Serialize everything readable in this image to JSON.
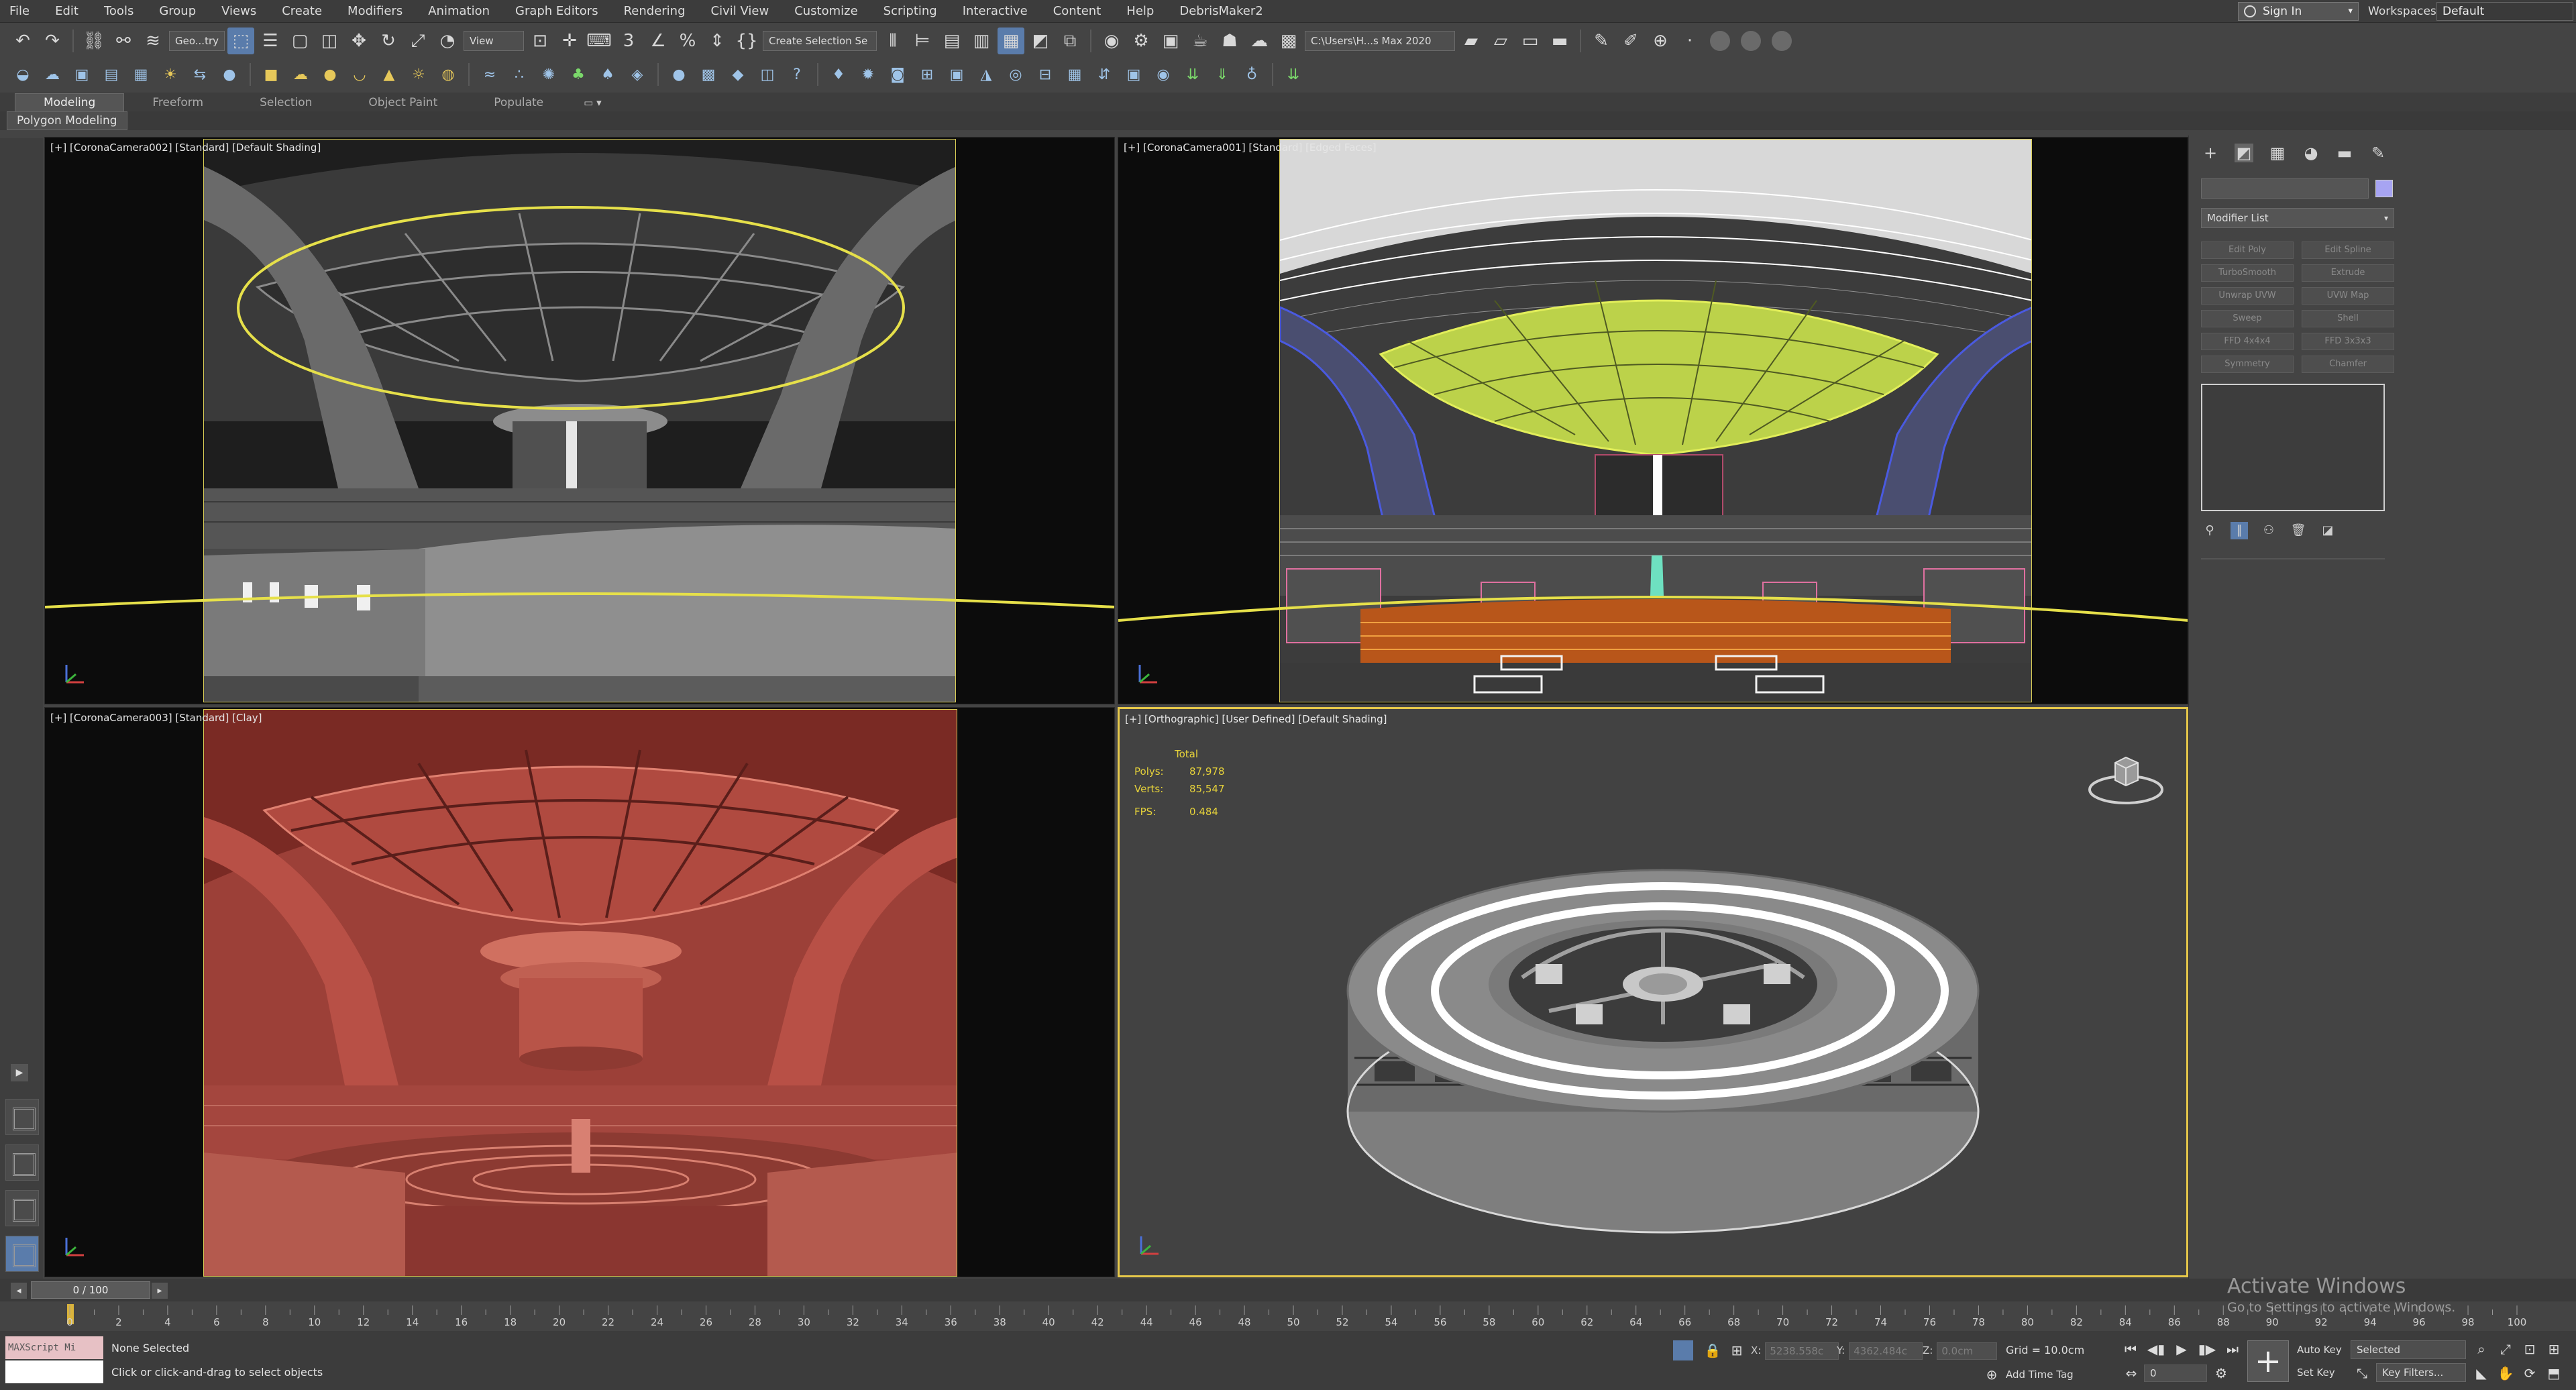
{
  "menubar": {
    "items": [
      "File",
      "Edit",
      "Tools",
      "Group",
      "Views",
      "Create",
      "Modifiers",
      "Animation",
      "Graph Editors",
      "Rendering",
      "Civil View",
      "Customize",
      "Scripting",
      "Interactive",
      "Content",
      "Help",
      "DebrisMaker2"
    ],
    "sign_in": "Sign In",
    "workspaces_label": "Workspaces:",
    "workspace_value": "Default"
  },
  "toolbar": {
    "selection_filter": "Geo...try",
    "ref_coord": "View",
    "selection_set": "Create Selection Se",
    "project_path": "C:\\Users\\H...s Max 2020"
  },
  "ribbon": {
    "tabs": [
      "Modeling",
      "Freeform",
      "Selection",
      "Object Paint",
      "Populate"
    ],
    "panel_label": "Polygon Modeling"
  },
  "viewports": {
    "tl_label": "[+] [CoronaCamera002] [Standard] [Default Shading]",
    "tr_label": "[+] [CoronaCamera001] [Standard] [Edged Faces]",
    "bl_label": "[+] [CoronaCamera003] [Standard] [Clay]",
    "br_label": "[+] [Orthographic] [User Defined] [Default Shading]",
    "stats": {
      "total_label": "Total",
      "polys_label": "Polys:",
      "polys_value": "87,978",
      "verts_label": "Verts:",
      "verts_value": "85,547",
      "fps_label": "FPS:",
      "fps_value": "0.484"
    }
  },
  "command_panel": {
    "modifier_list": "Modifier List",
    "modifiers": [
      "Edit Poly",
      "Edit Spline",
      "TurboSmooth",
      "Extrude",
      "Unwrap UVW",
      "UVW Map",
      "Sweep",
      "Shell",
      "FFD 4x4x4",
      "FFD 3x3x3",
      "Symmetry",
      "Chamfer"
    ],
    "object_color": "#a7a4f2"
  },
  "timeline": {
    "frame_display": "0 / 100",
    "ticks": [
      0,
      2,
      4,
      6,
      8,
      10,
      12,
      14,
      16,
      18,
      20,
      22,
      24,
      26,
      28,
      30,
      32,
      34,
      36,
      38,
      40,
      42,
      44,
      46,
      48,
      50,
      52,
      54,
      56,
      58,
      60,
      62,
      64,
      66,
      68,
      70,
      72,
      74,
      76,
      78,
      80,
      82,
      84,
      86,
      88,
      90,
      92,
      94,
      96,
      98,
      100
    ]
  },
  "status": {
    "maxscript": "MAXScript Mi",
    "selection": "None Selected",
    "hint": "Click or click-and-drag to select objects",
    "x_label": "X:",
    "x_value": "5238.558c",
    "y_label": "Y:",
    "y_value": "4362.484c",
    "z_label": "Z:",
    "z_value": "0.0cm",
    "grid": "Grid = 10.0cm",
    "add_time_tag": "Add Time Tag",
    "frame_value": "0",
    "auto_key": "Auto Key",
    "selected_dropdown": "Selected",
    "set_key": "Set Key",
    "key_filters": "Key Filters..."
  },
  "watermark": {
    "title": "Activate Windows",
    "subtitle": "Go to Settings to activate Windows."
  }
}
